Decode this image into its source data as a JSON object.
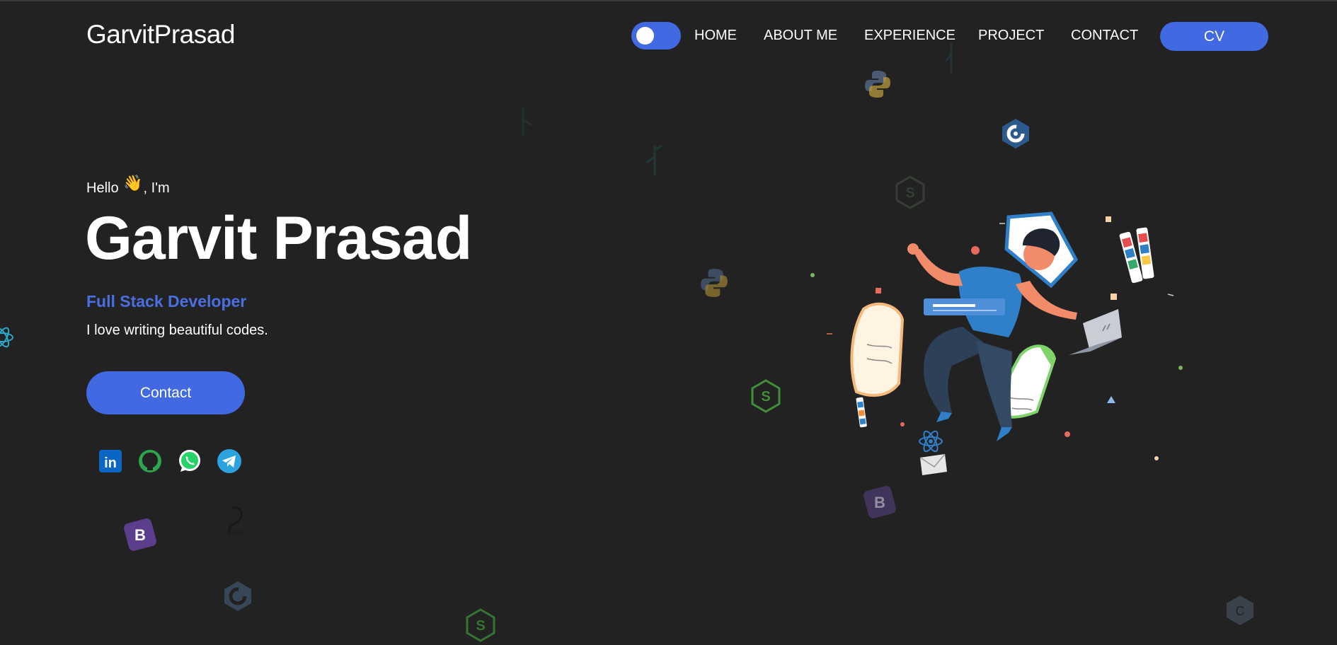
{
  "navbar": {
    "logo": "GarvitPrasad",
    "links": [
      "HOME",
      "ABOUT ME",
      "EXPERIENCE",
      "PROJECT",
      "CONTACT"
    ],
    "cv_label": "CV"
  },
  "hero": {
    "greeting_prefix": "Hello",
    "greeting_suffix": ", I'm",
    "wave_icon": "waving-hand-icon",
    "name": "Garvit Prasad",
    "role": "Full Stack Developer",
    "tagline": "I love writing beautiful codes.",
    "contact_label": "Contact"
  },
  "socials": [
    {
      "icon": "linkedin-icon",
      "label": "in"
    },
    {
      "icon": "github-icon"
    },
    {
      "icon": "whatsapp-icon"
    },
    {
      "icon": "telegram-icon"
    }
  ],
  "background_icons": [
    "python-icon",
    "cpp-icon",
    "nodejs-icon",
    "react-icon",
    "bootstrap-icon",
    "flask-icon",
    "tensorflow-icon",
    "c-icon"
  ],
  "illustration": "developer-illustration",
  "colors": {
    "background": "#222222",
    "accent": "#4169e1",
    "role_text": "#4a6fe3",
    "text": "#ffffff"
  }
}
